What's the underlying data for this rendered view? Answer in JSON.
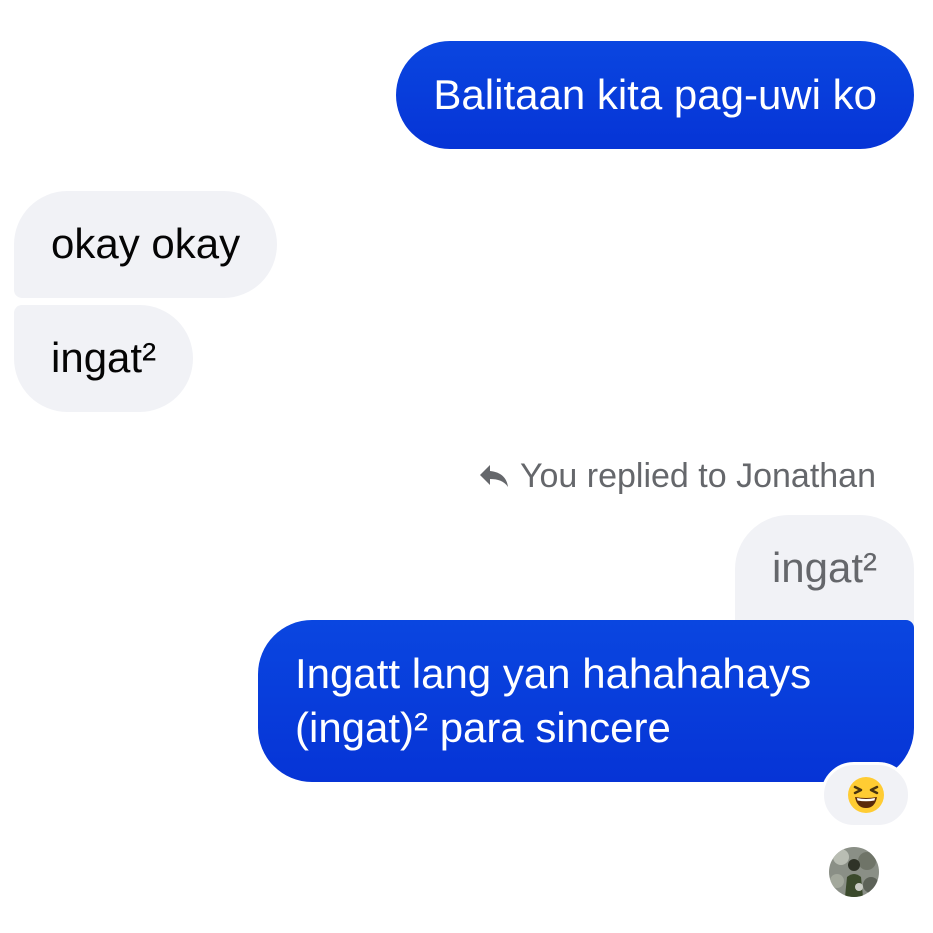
{
  "colors": {
    "outgoing_bubble": "#0a46e0",
    "incoming_bubble": "#f1f2f6",
    "meta_text": "#65676b"
  },
  "messages": [
    {
      "direction": "outgoing",
      "text": "Balitaan kita pag-uwi ko"
    },
    {
      "direction": "incoming",
      "text": "okay okay"
    },
    {
      "direction": "incoming",
      "text": "ingat²"
    },
    {
      "direction": "outgoing",
      "text": "Ingatt lang yan hahahahays (ingat)² para sincere"
    }
  ],
  "reply": {
    "icon": "reply-arrow-icon",
    "label": "You replied to Jonathan",
    "quoted_text": "ingat²"
  },
  "reaction": {
    "emoji_name": "grinning-squinting-face",
    "icon": "laughing-emoji-icon"
  },
  "seen_indicator": {
    "icon": "seen-avatar"
  }
}
